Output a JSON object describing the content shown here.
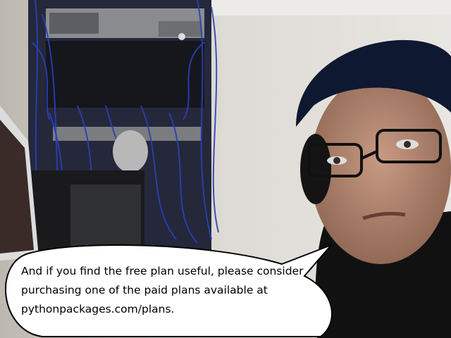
{
  "speech_bubble": {
    "text": "And if you find the free plan useful, please consider purchasing one of the paid plans available at pythonpackages.com/plans."
  },
  "colors": {
    "wall": "#d9d6d0",
    "cable_blue": "#2b3fb8",
    "bubble_fill": "#ffffff",
    "bubble_stroke": "#000000"
  }
}
